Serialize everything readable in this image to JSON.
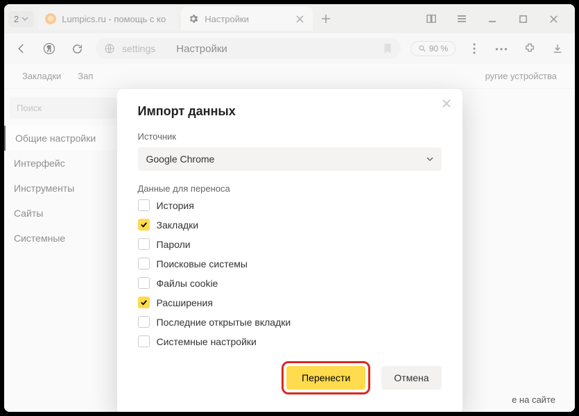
{
  "window": {
    "tab_count": "2"
  },
  "tabs": [
    {
      "title": "Lumpics.ru - помощь с ко",
      "favicon_color": "#f7a23c"
    },
    {
      "title": "Настройки",
      "favicon_gear": true,
      "active": true
    }
  ],
  "addressbar": {
    "site": "settings",
    "title": "Настройки",
    "zoom": "90 %"
  },
  "bookmarks": {
    "items": [
      "Закладки",
      "Зап"
    ],
    "other": "ругие устройства"
  },
  "sidebar": {
    "search_placeholder": "Поиск",
    "items": [
      {
        "label": "Общие настройки",
        "active": true
      },
      {
        "label": "Интерфейс"
      },
      {
        "label": "Инструменты"
      },
      {
        "label": "Сайты"
      },
      {
        "label": "Системные"
      }
    ]
  },
  "modal": {
    "title": "Импорт данных",
    "source_label": "Источник",
    "source_value": "Google Chrome",
    "data_label": "Данные для переноса",
    "checks": [
      {
        "label": "История",
        "checked": false
      },
      {
        "label": "Закладки",
        "checked": true
      },
      {
        "label": "Пароли",
        "checked": false
      },
      {
        "label": "Поисковые системы",
        "checked": false
      },
      {
        "label": "Файлы cookie",
        "checked": false
      },
      {
        "label": "Расширения",
        "checked": true
      },
      {
        "label": "Последние открытые вкладки",
        "checked": false
      },
      {
        "label": "Системные настройки",
        "checked": false
      }
    ],
    "primary": "Перенести",
    "secondary": "Отмена"
  },
  "peek_text": "е на сайте"
}
